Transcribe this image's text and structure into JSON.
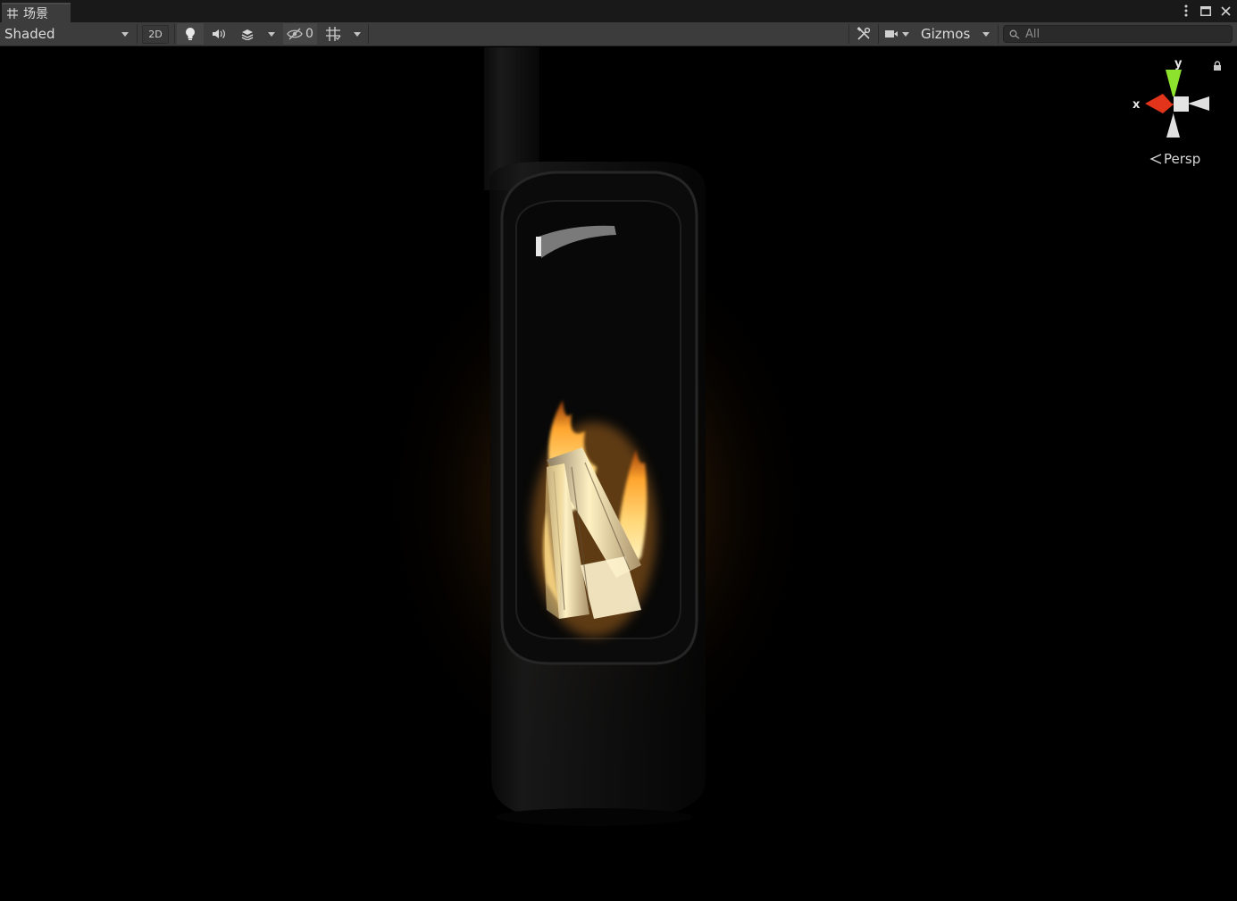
{
  "tab": {
    "title": "场景",
    "icon": "grid-icon"
  },
  "window_controls": [
    "kebab-menu-icon",
    "maximize-icon",
    "close-icon"
  ],
  "toolbar": {
    "draw_mode": "Shaded",
    "btn_2d": "2D",
    "hidden_count": "0",
    "gizmos_label": "Gizmos",
    "search_placeholder": "All"
  },
  "gizmo": {
    "x_label": "x",
    "y_label": "y",
    "projection": "Persp",
    "colors": {
      "x": "#e2331b",
      "y": "#8ce22c",
      "neutral": "#e0e0e0"
    }
  },
  "scene": {
    "description_colors": {
      "fire_core": "#fff6c8",
      "fire_mid": "#ffb43c",
      "glow": "#7a4a10"
    }
  }
}
